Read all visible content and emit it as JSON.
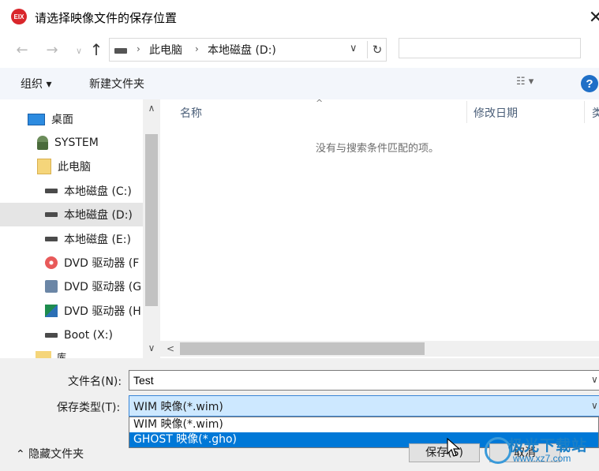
{
  "window": {
    "title": "请选择映像文件的保存位置",
    "app_icon_text": "EIX",
    "close_glyph": "✕"
  },
  "address_bar": {
    "breadcrumbs": [
      "此电脑",
      "本地磁盘 (D:)"
    ],
    "search_placeholder": ""
  },
  "toolbar": {
    "organize_label": "组织 ▾",
    "new_folder_label": "新建文件夹",
    "view_label": "☷ ▾",
    "help_label": "?"
  },
  "nav_tree": [
    {
      "label": "桌面",
      "icon": "desktop-icon"
    },
    {
      "label": "SYSTEM",
      "icon": "user-icon"
    },
    {
      "label": "此电脑",
      "icon": "this-pc-icon"
    },
    {
      "label": "本地磁盘 (C:)",
      "icon": "drive-icon"
    },
    {
      "label": "本地磁盘 (D:)",
      "icon": "drive-icon",
      "selected": true
    },
    {
      "label": "本地磁盘 (E:)",
      "icon": "drive-icon"
    },
    {
      "label": "DVD 驱动器 (F",
      "icon": "dvd-icon"
    },
    {
      "label": "DVD 驱动器 (G",
      "icon": "dvd-icon"
    },
    {
      "label": "DVD 驱动器 (H",
      "icon": "dvd-icon"
    },
    {
      "label": "Boot (X:)",
      "icon": "drive-icon"
    }
  ],
  "partial_item": "库",
  "file_list": {
    "columns": [
      "名称",
      "修改日期",
      "类"
    ],
    "empty_message": "没有与搜索条件匹配的项。"
  },
  "form": {
    "filename_label": "文件名(N):",
    "filename_value": "Test",
    "type_label": "保存类型(T):",
    "type_selected": "WIM 映像(*.wim)",
    "type_options": [
      "WIM 映像(*.wim)",
      "GHOST 映像(*.gho)"
    ],
    "hide_folders_label": "⌃ 隐藏文件夹",
    "save_label": "保存(S)",
    "cancel_label": "取消"
  },
  "watermark": {
    "text": "极光下载站",
    "url": "www.xz7.com"
  }
}
